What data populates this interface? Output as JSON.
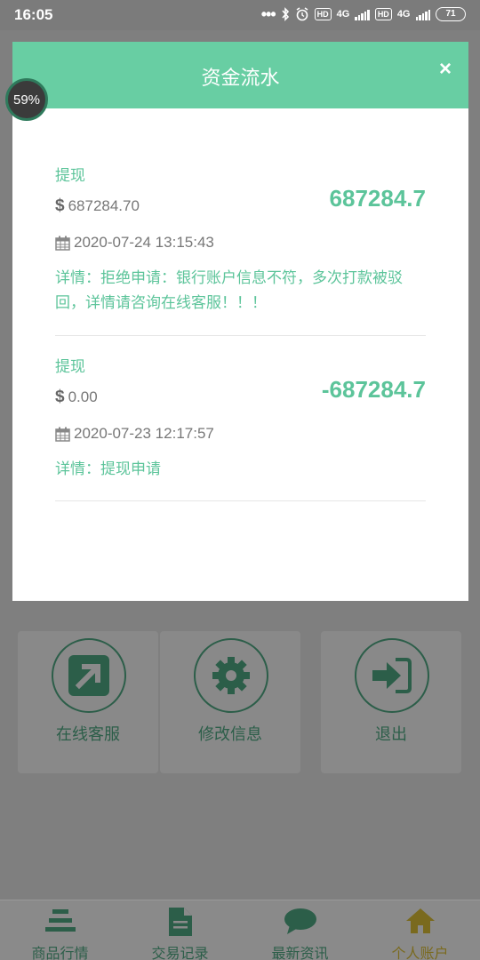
{
  "status_bar": {
    "time": "16:05",
    "net1": "4G",
    "net2": "4G",
    "hd1": "HD",
    "hd2": "HD",
    "battery": "71"
  },
  "overlay": {
    "progress_label": "59%"
  },
  "modal": {
    "title": "资金流水",
    "close_label": "×",
    "records": [
      {
        "type": "提现",
        "balance": "687284.70",
        "amount": "687284.7",
        "time": "2020-07-24 13:15:43",
        "detail": "详情：拒绝申请：银行账户信息不符，多次打款被驳回，详情请咨询在线客服！！！"
      },
      {
        "type": "提现",
        "balance": "0.00",
        "amount": "-687284.7",
        "time": "2020-07-23 12:17:57",
        "detail": "详情：提现申请"
      }
    ]
  },
  "grid": {
    "customer_service": "在线客服",
    "edit_info": "修改信息",
    "logout": "退出"
  },
  "tabs": [
    {
      "label": "商品行情",
      "icon": "list-icon"
    },
    {
      "label": "交易记录",
      "icon": "document-icon"
    },
    {
      "label": "最新资讯",
      "icon": "chat-icon"
    },
    {
      "label": "个人账户",
      "icon": "home-icon",
      "active": true
    }
  ],
  "colors": {
    "accent": "#68cea3",
    "text_green": "#5cc49a",
    "muted_text": "#777777",
    "active_tab": "#7a6a1e"
  }
}
